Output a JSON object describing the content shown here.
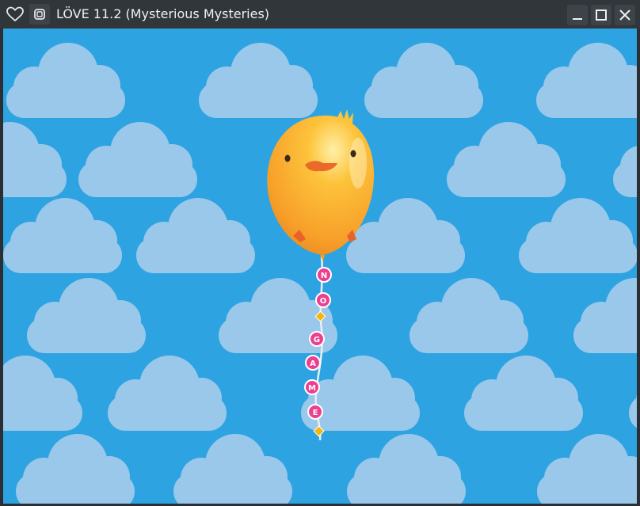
{
  "window": {
    "title": "LÖVE 11.2 (Mysterious Mysteries)",
    "buttons": [
      "minimize",
      "maximize",
      "close"
    ],
    "left_icons": [
      "heart-icon",
      "app-menu-icon"
    ]
  },
  "scene": {
    "background_color": "#2ea3e2",
    "cloud_color": "#9ac8ea",
    "balloon_color": "#f9ab2c",
    "bead_color": "#ee3e8f",
    "balloon_string_letters": [
      "N",
      "O",
      "G",
      "A",
      "M",
      "E"
    ]
  }
}
